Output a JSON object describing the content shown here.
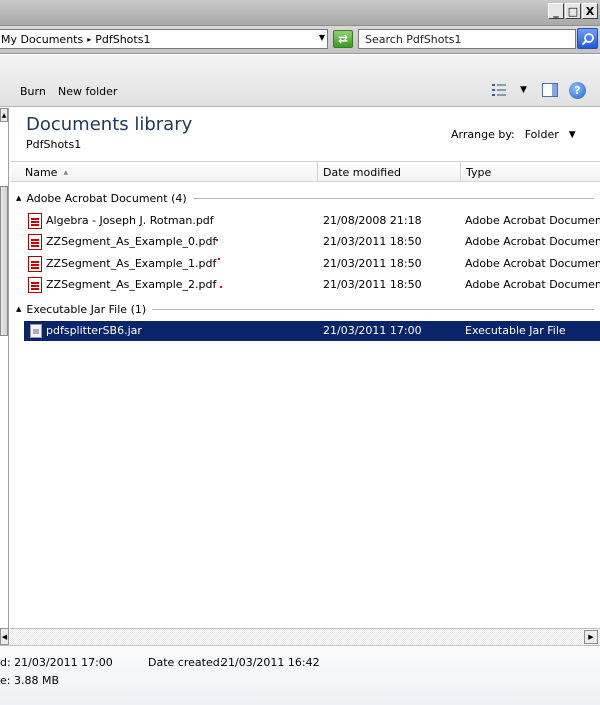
{
  "window": {
    "minimize_label": "_",
    "maximize_label": "□",
    "close_label": "X"
  },
  "address": {
    "crumbs": [
      "My Documents",
      "PdfShots1"
    ],
    "separator_glyph": "▸",
    "dropdown_glyph": "▼",
    "refresh_glyph": "⇄"
  },
  "search": {
    "placeholder": "Search PdfShots1"
  },
  "toolbar": {
    "burn_label": "Burn",
    "new_folder_label": "New folder",
    "view_dropdown_glyph": "▼",
    "help_glyph": "?"
  },
  "library": {
    "title": "Documents library",
    "subtitle": "PdfShots1",
    "arrange_label": "Arrange by:",
    "arrange_value": "Folder",
    "arrange_glyph": "▼"
  },
  "columns": {
    "name": "Name",
    "date_modified": "Date modified",
    "type": "Type"
  },
  "groups": [
    {
      "label": "Adobe Acrobat Document (4)",
      "files": [
        {
          "name": "Algebra - Joseph J. Rotman.pdf",
          "date": "21/08/2008 21:18",
          "type": "Adobe Acrobat Document"
        },
        {
          "name": "ZZSegment_As_Example_0.pdf",
          "date": "21/03/2011 18:50",
          "type": "Adobe Acrobat Document"
        },
        {
          "name": "ZZSegment_As_Example_1.pdf",
          "date": "21/03/2011 18:50",
          "type": "Adobe Acrobat Document"
        },
        {
          "name": "ZZSegment_As_Example_2.pdf",
          "date": "21/03/2011 18:50",
          "type": "Adobe Acrobat Document"
        }
      ]
    },
    {
      "label": "Executable Jar File (1)",
      "files": [
        {
          "name": "pdfsplitterSB6.jar",
          "date": "21/03/2011 17:00",
          "type": "Executable Jar File",
          "selected": true
        }
      ]
    }
  ],
  "details": {
    "modified_text": "d: 21/03/2011 17:00",
    "created_label": "Date created:",
    "created_value": "21/03/2011 16:42",
    "size_text": "e: 3.88 MB"
  },
  "colors": {
    "selection": "#0a246a",
    "title_blue": "#1e395b"
  }
}
